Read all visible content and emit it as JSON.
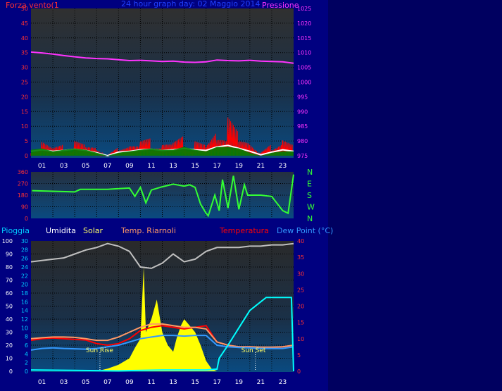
{
  "chart_data": [
    {
      "type": "line",
      "title": "24 hour graph day: 02 Maggio 2014",
      "left_label": "Forza vento(1",
      "right_label": "Pressione",
      "x_ticks": [
        "01",
        "03",
        "05",
        "07",
        "09",
        "11",
        "13",
        "15",
        "17",
        "19",
        "21",
        "23"
      ],
      "y_left_ticks": [
        "0",
        "5",
        "10",
        "15",
        "20",
        "25",
        "30",
        "35",
        "40",
        "45",
        "50"
      ],
      "y_left_range": [
        0,
        50
      ],
      "y_right_ticks": [
        "975",
        "980",
        "985",
        "990",
        "995",
        "1000",
        "1005",
        "1010",
        "1015",
        "1020",
        "1025"
      ],
      "y_right_range": [
        975,
        1025
      ],
      "series": [
        {
          "key": "pressure",
          "axis": "right",
          "color": "#ff33ff",
          "x": [
            0,
            1,
            2,
            3,
            4,
            5,
            6,
            7,
            8,
            9,
            10,
            11,
            12,
            13,
            14,
            15,
            16,
            17,
            18,
            19,
            20,
            21,
            22,
            23,
            24
          ],
          "values": [
            1010.2,
            1009.9,
            1009.5,
            1009.0,
            1008.6,
            1008.2,
            1008.0,
            1007.9,
            1007.6,
            1007.3,
            1007.4,
            1007.2,
            1007.0,
            1007.1,
            1006.8,
            1006.7,
            1006.9,
            1007.5,
            1007.3,
            1007.2,
            1007.4,
            1007.1,
            1007.0,
            1006.9,
            1006.4
          ]
        },
        {
          "key": "wind_gust",
          "axis": "left",
          "color": "#ff0000",
          "style": "spiky",
          "x": [
            0,
            1,
            2,
            3,
            4,
            5,
            6,
            7,
            8,
            9,
            10,
            11,
            12,
            13,
            14,
            15,
            16,
            17,
            18,
            19,
            20,
            21,
            22,
            23,
            24
          ],
          "values": [
            3,
            5,
            3,
            4,
            5,
            4,
            3,
            0,
            3,
            4,
            5,
            6,
            4,
            5,
            7,
            5,
            4,
            9,
            13,
            8,
            5,
            1,
            4,
            6,
            5
          ]
        },
        {
          "key": "wind_avg",
          "axis": "left",
          "color": "#ffffff",
          "x": [
            0,
            1,
            2,
            3,
            4,
            5,
            6,
            7,
            8,
            9,
            10,
            11,
            12,
            13,
            14,
            15,
            16,
            17,
            18,
            19,
            20,
            21,
            22,
            23,
            24
          ],
          "values": [
            1.5,
            2,
            1.5,
            1.8,
            2.2,
            1.8,
            1,
            0,
            1.2,
            1.5,
            2,
            2.2,
            1.8,
            2,
            2.5,
            2,
            1.8,
            3,
            3.5,
            2.5,
            1.5,
            0.3,
            1.2,
            2,
            1.5
          ]
        },
        {
          "key": "wind_fill",
          "axis": "left",
          "color": "#008000",
          "style": "area",
          "x": [
            0,
            1,
            2,
            3,
            4,
            5,
            6,
            7,
            8,
            9,
            10,
            11,
            12,
            13,
            14,
            15,
            16,
            17,
            18,
            19,
            20,
            21,
            22,
            23,
            24
          ],
          "values": [
            2,
            2.5,
            1.5,
            2,
            2.5,
            2,
            1,
            0,
            1,
            1.5,
            2,
            2.5,
            2,
            2,
            3,
            2,
            1.5,
            3,
            3,
            2.5,
            1,
            0,
            1,
            1.5,
            1.5
          ]
        }
      ]
    },
    {
      "type": "line",
      "y_left_ticks": [
        "0",
        "90",
        "180",
        "270",
        "360"
      ],
      "y_left_range": [
        0,
        360
      ],
      "compass_ticks": [
        "N",
        "W",
        "S",
        "E",
        "N"
      ],
      "x_ticks": [
        "01",
        "03",
        "05",
        "07",
        "09",
        "11",
        "13",
        "15",
        "17",
        "19",
        "21",
        "23"
      ],
      "series": [
        {
          "key": "wind_dir",
          "color": "#33ff33",
          "x": [
            0.1,
            2,
            4,
            4.5,
            7,
            8,
            9,
            9.5,
            10,
            10.5,
            11,
            12,
            13,
            14,
            14.5,
            15,
            15.5,
            16,
            16.2,
            16.8,
            17.2,
            17.5,
            18,
            18.5,
            19,
            19.5,
            19.8,
            20.5,
            21,
            22,
            23,
            23.5,
            24
          ],
          "values": [
            215,
            210,
            205,
            225,
            225,
            230,
            235,
            170,
            240,
            120,
            220,
            245,
            265,
            250,
            260,
            240,
            110,
            40,
            20,
            180,
            60,
            300,
            80,
            330,
            70,
            260,
            180,
            180,
            180,
            170,
            60,
            40,
            340
          ]
        }
      ]
    },
    {
      "type": "line",
      "legend": [
        "Pioggia",
        "Umidita",
        "Solar",
        "Temp. Riarnoli",
        "Temperatura",
        "Dew Point (°C)"
      ],
      "legend_colors": [
        "#00ccff",
        "#ffffff",
        "#ffff66",
        "#ff9966",
        "#ff0000",
        "#3399ff"
      ],
      "y_far_left_ticks": [
        "0",
        "10",
        "20",
        "30",
        "40",
        "50",
        "60",
        "70",
        "80",
        "90",
        "100"
      ],
      "y_far_left_range": [
        0,
        100
      ],
      "y_left_ticks": [
        "0",
        "2",
        "4",
        "6",
        "8",
        "10",
        "12",
        "14",
        "16",
        "18",
        "20",
        "22",
        "24",
        "26",
        "28",
        "30"
      ],
      "y_left_range": [
        0,
        30
      ],
      "y_right_ticks": [
        "0",
        "5",
        "10",
        "15",
        "20",
        "25",
        "30",
        "35",
        "40"
      ],
      "y_right_range": [
        0,
        40
      ],
      "x_ticks": [
        "01",
        "03",
        "05",
        "07",
        "09",
        "11",
        "13",
        "15",
        "17",
        "19",
        "21",
        "23"
      ],
      "annotations": [
        {
          "text": "Sun Rise",
          "x": 6.3
        },
        {
          "text": "Sun Set",
          "x": 20.5
        }
      ],
      "series": [
        {
          "key": "humidity",
          "axis": "far_left",
          "color": "#c0c0c0",
          "x": [
            0,
            1,
            2,
            3,
            4,
            5,
            6,
            7,
            8,
            9,
            10,
            11,
            12,
            13,
            14,
            15,
            16,
            17,
            18,
            19,
            20,
            21,
            22,
            23,
            24
          ],
          "values": [
            84,
            85,
            86,
            87,
            90,
            93,
            95,
            98,
            96,
            92,
            80,
            79,
            83,
            90,
            84,
            86,
            92,
            95,
            95,
            95,
            96,
            96,
            97,
            97,
            98
          ]
        },
        {
          "key": "solar",
          "axis": "far_left",
          "color": "#ffff00",
          "style": "area",
          "x": [
            6,
            7,
            8,
            9,
            9.5,
            10,
            10.3,
            10.5,
            11,
            11.5,
            12,
            12.5,
            13,
            13.3,
            13.7,
            14,
            14.5,
            15,
            15.5,
            16,
            16.5,
            17
          ],
          "values": [
            0,
            2,
            5,
            10,
            18,
            25,
            80,
            30,
            40,
            55,
            30,
            20,
            15,
            25,
            35,
            40,
            35,
            30,
            20,
            8,
            2,
            0
          ]
        },
        {
          "key": "temp_ext",
          "axis": "right",
          "color": "#ff0000",
          "x": [
            0,
            1,
            2,
            3,
            4,
            5,
            6,
            7,
            8,
            9,
            10,
            11,
            12,
            13,
            14,
            15,
            16,
            17,
            18,
            19,
            20,
            21,
            22,
            23,
            24
          ],
          "values": [
            9.5,
            10,
            10.2,
            10,
            9.8,
            9.6,
            8.5,
            8,
            8.5,
            10,
            12.5,
            13.5,
            14,
            13.5,
            13,
            13.5,
            14,
            9,
            8,
            7.5,
            7.5,
            7.3,
            7.3,
            7.5,
            8
          ]
        },
        {
          "key": "temp_app",
          "axis": "right",
          "color": "#ff9966",
          "x": [
            0,
            1,
            2,
            3,
            4,
            5,
            6,
            7,
            8,
            9,
            10,
            11,
            12,
            13,
            14,
            15,
            16,
            17,
            18,
            19,
            20,
            21,
            22,
            23,
            24
          ],
          "values": [
            10,
            10.3,
            10.5,
            10.5,
            10.4,
            10,
            9.5,
            9.5,
            10.5,
            12,
            13.5,
            14.5,
            14.5,
            14,
            13.5,
            13.5,
            13,
            9,
            8,
            7.5,
            7.5,
            7.4,
            7.4,
            7.5,
            8
          ]
        },
        {
          "key": "dew_point",
          "axis": "right",
          "color": "#3399ff",
          "x": [
            0,
            1,
            2,
            3,
            4,
            5,
            6,
            7,
            8,
            9,
            10,
            11,
            12,
            13,
            14,
            15,
            16,
            17,
            18,
            19,
            20,
            21,
            22,
            23,
            24
          ],
          "values": [
            6.5,
            7,
            7.2,
            7,
            6.9,
            6.8,
            7,
            7.5,
            8,
            9,
            10,
            10.5,
            11,
            11,
            10.8,
            11,
            11,
            8,
            7.5,
            7.3,
            7.2,
            7,
            7,
            7,
            7.5
          ]
        },
        {
          "key": "rain",
          "axis": "left",
          "color": "#00ffff",
          "x": [
            0,
            4,
            8,
            12,
            16,
            17,
            17.2,
            18,
            19,
            20,
            21,
            21.5,
            22,
            23,
            23.8,
            24
          ],
          "values": [
            0.3,
            0.2,
            0.1,
            0.3,
            0.3,
            0.5,
            3,
            6,
            10,
            14,
            16,
            17,
            17,
            17,
            17,
            0
          ]
        }
      ]
    }
  ]
}
